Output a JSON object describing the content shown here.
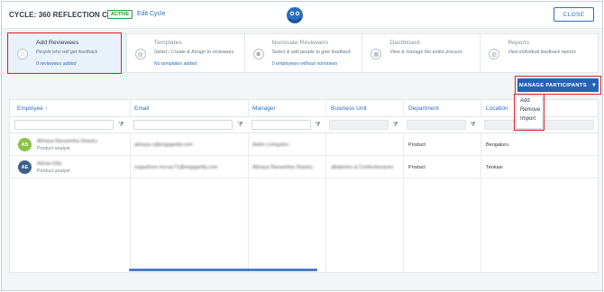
{
  "header": {
    "cycle_title": "CYCLE: 360 REFLECTION CYCLE",
    "status_badge": "ACTIVE",
    "edit_label": "Edit Cycle",
    "close_label": "CLOSE"
  },
  "steps": [
    {
      "icon": "user-plus-icon",
      "title": "Add Reviewees",
      "desc": "People who will get feedback",
      "sub": "0  reviewees added",
      "active": true
    },
    {
      "icon": "template-icon",
      "title": "Templates",
      "desc": "Select / Create & Assign to reviewees",
      "sub": "No templates added",
      "active": false
    },
    {
      "icon": "users-icon",
      "title": "Nominate Reviewers",
      "desc": "Select & add people to give feedback",
      "sub": "0  employees without nominees",
      "active": false
    },
    {
      "icon": "dashboard-icon",
      "title": "Dashboard",
      "desc": "View & manage the entire process",
      "sub": "",
      "active": false
    },
    {
      "icon": "reports-icon",
      "title": "Reports",
      "desc": "View individual feedback reports",
      "sub": "",
      "active": false
    }
  ],
  "manage": {
    "label": "MANAGE PARTICIPANTS",
    "menu": [
      "Add",
      "Remove",
      "Import"
    ]
  },
  "table": {
    "columns": [
      "Employee",
      "Email",
      "Manager",
      "Business Unit",
      "Department",
      "Location"
    ],
    "sort_indicator": "↑",
    "rows": [
      {
        "initials": "AS",
        "avatar_color": "#8bc34a",
        "name": "Abhaya Narasimha Shastry",
        "role": "Product analyst",
        "email": "abhaya.s@engagedly.com",
        "manager": "Aiden Livingston",
        "business_unit": "",
        "department": "Product",
        "location": "Bengaluru"
      },
      {
        "initials": "AE",
        "avatar_color": "#3f5f8a",
        "name": "Adrian Ellis",
        "role": "Product analyst",
        "email": "nagashree.ms+pc71@engagedly.com",
        "manager": "Abhaya Narasimha Shastry",
        "business_unit": "aBakeries & Confectionaries",
        "department": "Product",
        "location": "Tenkasi"
      }
    ]
  },
  "colors": {
    "accent": "#2563b8",
    "link": "#2a6fbd",
    "highlight_outline": "#d3292c",
    "active_badge": "#2e9b4e"
  }
}
